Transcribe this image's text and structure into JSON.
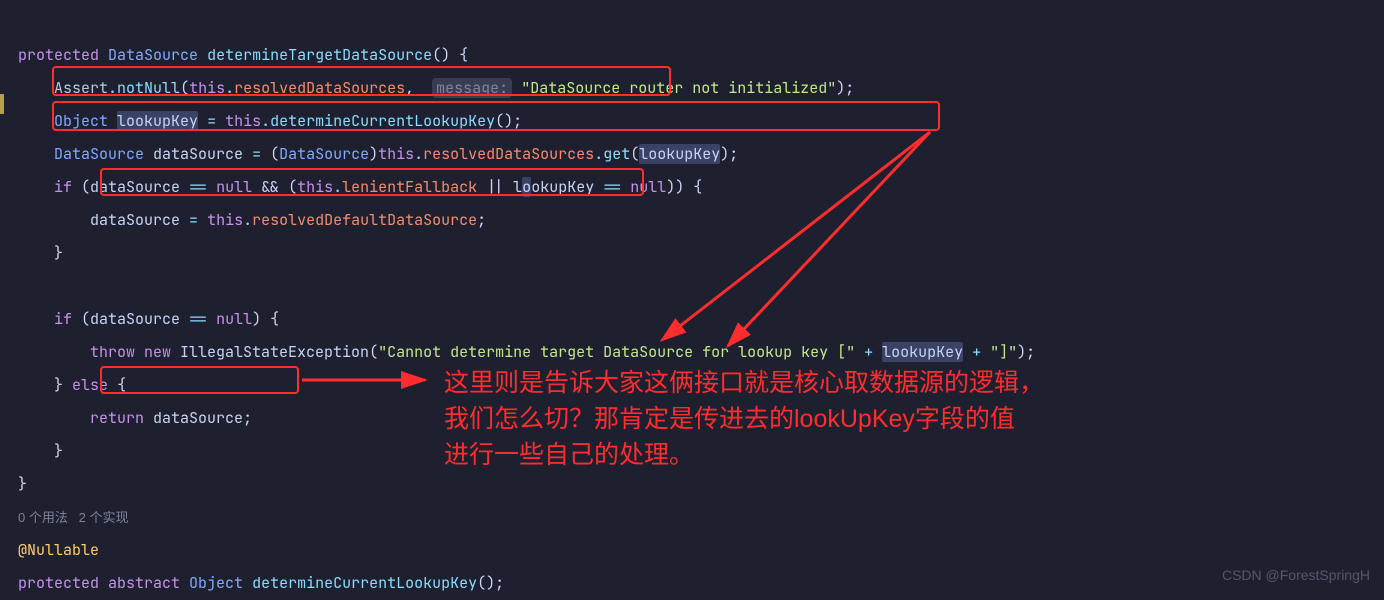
{
  "code": {
    "l1": {
      "kw_protected": "protected",
      "type": "DataSource",
      "fn": "determineTargetDataSource",
      "tail": "() {"
    },
    "l2": {
      "assert": "Assert",
      "dot1": ".",
      "notNull": "notNull",
      "open": "(",
      "this": "this",
      "dot2": ".",
      "field": "resolvedDataSources",
      "comma": ", ",
      "hint": "message:",
      "sp": " ",
      "str": "\"DataSource router not initialized\"",
      "close": ");"
    },
    "l3": {
      "type": "Object",
      "sp1": " ",
      "var": "lookupKey",
      "sp2": " ",
      "eq": "=",
      "sp3": " ",
      "this": "this",
      "dot": ".",
      "fn": "determineCurrentLookupKey",
      "tail": "();"
    },
    "l4": {
      "type1": "DataSource",
      "sp1": " ",
      "var": "dataSource",
      "sp2": " ",
      "eq": "=",
      "sp3": " (",
      "type2": "DataSource",
      "cast": ")",
      "this": "this",
      "dot": ".",
      "field": "resolvedDataSources",
      "dot2": ".",
      "get": "get",
      "open": "(",
      "arg": "lookupKey",
      "close": ");"
    },
    "l5": {
      "if": "if",
      "open": " (dataSource ",
      "eq": "==",
      "sp": " ",
      "nul": "null",
      "and": " && (",
      "this": "this",
      "dot": ".",
      "field": "lenientFallback",
      "or": " || l",
      "hlchar": "o",
      "rest": "okupKey ",
      "eq2": "==",
      "sp2": " ",
      "nul2": "null",
      "close": ")) {"
    },
    "l6": {
      "var": "dataSource",
      "sp": " ",
      "eq": "=",
      "sp2": " ",
      "this": "this",
      "dot": ".",
      "field": "resolvedDefaultDataSource",
      "semi": ";"
    },
    "l7": {
      "brace": "}"
    },
    "l9": {
      "if": "if",
      "open": " (dataSource ",
      "eq": "==",
      "sp": " ",
      "nul": "null",
      "close": ") {"
    },
    "l10": {
      "throw": "throw new",
      "sp": " ",
      "type": "IllegalStateException",
      "open": "(",
      "str1": "\"Cannot determine target DataSource for lookup key [\"",
      "plus1": " + ",
      "var": "lookupKey",
      "plus2": " + ",
      "str2": "\"]\"",
      "close": ");"
    },
    "l11a": {
      "brace": "}",
      "sp": " ",
      "else": "else",
      "open": " {"
    },
    "l12": {
      "return": "return",
      "sp": " ",
      "var": "dataSource",
      "semi": ";"
    },
    "l13": {
      "brace": "}"
    },
    "l14": {
      "brace": "}"
    },
    "meta": "0 个用法   2 个实现",
    "l16": {
      "ann": "@Nullable"
    },
    "l17": {
      "kw1": "protected abstract",
      "sp": " ",
      "type": "Object",
      "sp2": " ",
      "fn": "determineCurrentLookupKey",
      "tail": "();"
    }
  },
  "annotation": {
    "line1": "这里则是告诉大家这俩接口就是核心取数据源的逻辑，",
    "line2": "我们怎么切？那肯定是传进去的lookUpKey字段的值",
    "line3": "进行一些自己的处理。"
  },
  "watermark": "CSDN @ForestSpringH"
}
